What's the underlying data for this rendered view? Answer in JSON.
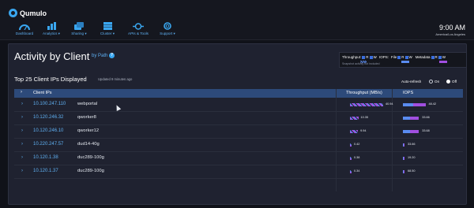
{
  "brand": {
    "name": "Qumulo"
  },
  "nav": [
    {
      "label": "Dashboard",
      "icon": "dashboard-icon"
    },
    {
      "label": "Analytics ▾",
      "icon": "analytics-icon"
    },
    {
      "label": "Sharing ▾",
      "icon": "sharing-icon"
    },
    {
      "label": "Cluster ▾",
      "icon": "cluster-icon"
    },
    {
      "label": "APIs & Tools",
      "icon": "apis-icon"
    },
    {
      "label": "Support ▾",
      "icon": "support-icon"
    }
  ],
  "clock": {
    "time": "9:00 AM",
    "zone": "America/Los Angeles"
  },
  "page": {
    "title": "Activity by Client",
    "by": "by Path",
    "subtitle": "Top 25 Client IPs Displayed",
    "updated": "Updated 9 minutes ago"
  },
  "legend": {
    "throughput": "Throughput:",
    "iops": "IOPS:",
    "file": "File",
    "metadata": "Metadata",
    "r": "R",
    "w": "W",
    "note": "Snapshot activity not included"
  },
  "autorefresh": {
    "label": "Auto-refresh",
    "on": "On",
    "off": "Off",
    "selected": "off"
  },
  "table": {
    "headers": {
      "ip": "Client IPs",
      "throughput": "Throughput (MB/s)",
      "iops": "IOPS"
    },
    "rows": [
      {
        "ip": "10.100.247.110",
        "host": "webportal",
        "throughput": "40.94",
        "iops": "48.42",
        "tp_fraction": 1.0,
        "iops_fraction": 0.38
      },
      {
        "ip": "10.120.246.32",
        "host": "qworker8",
        "throughput": "10.35",
        "iops": "33.66",
        "tp_fraction": 0.25,
        "iops_fraction": 0.27
      },
      {
        "ip": "10.120.246.10",
        "host": "qworker12",
        "throughput": "9.94",
        "iops": "33.68",
        "tp_fraction": 0.24,
        "iops_fraction": 0.27
      },
      {
        "ip": "10.220.247.57",
        "host": "dud14-40g",
        "throughput": "0.42",
        "iops": "33.66",
        "tp_fraction": 0.02,
        "iops_fraction": 0.02
      },
      {
        "ip": "10.120.1.38",
        "host": "duc289-100g",
        "throughput": "0.38",
        "iops": "19.20",
        "tp_fraction": 0,
        "iops_fraction": 0.02
      },
      {
        "ip": "10.120.1.37",
        "host": "duc289-100g",
        "throughput": "0.34",
        "iops": "68.50",
        "tp_fraction": 0,
        "iops_fraction": 0.02
      }
    ]
  },
  "colors": {
    "accent": "#3aa7f0",
    "read": "#5a8cf0",
    "write": "#a14fe0",
    "header": "#2d4a7a"
  }
}
